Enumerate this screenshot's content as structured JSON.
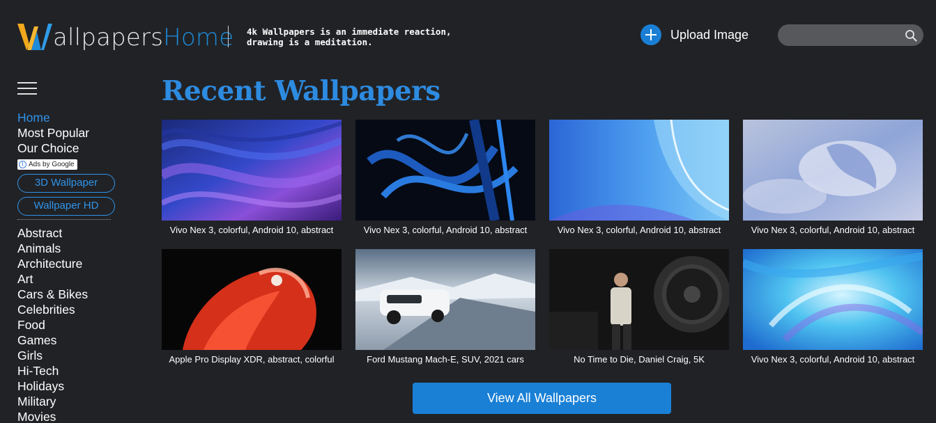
{
  "header": {
    "logo_wp": "allpapers",
    "logo_home": "Home",
    "tagline_line1": "4k Wallpapers is an immediate reaction,",
    "tagline_line2": "drawing is a meditation.",
    "upload_label": "Upload Image",
    "search_placeholder": ""
  },
  "sidebar": {
    "top_links": [
      {
        "label": "Home",
        "active": true
      },
      {
        "label": "Most Popular"
      },
      {
        "label": "Our Choice"
      }
    ],
    "ads_label": "Ads by Google",
    "pills": [
      "3D Wallpaper",
      "Wallpaper HD"
    ],
    "categories": [
      "Abstract",
      "Animals",
      "Architecture",
      "Art",
      "Cars & Bikes",
      "Celebrities",
      "Food",
      "Games",
      "Girls",
      "Hi-Tech",
      "Holidays",
      "Military",
      "Movies"
    ]
  },
  "main": {
    "title": "Recent Wallpapers",
    "wallpapers": [
      {
        "caption": "Vivo Nex 3, colorful, Android 10, abstract",
        "theme": "purple-waves"
      },
      {
        "caption": "Vivo Nex 3, colorful, Android 10, abstract",
        "theme": "dark-blue-stripes"
      },
      {
        "caption": "Vivo Nex 3, colorful, Android 10, abstract",
        "theme": "light-blue-curve"
      },
      {
        "caption": "Vivo Nex 3, colorful, Android 10, abstract",
        "theme": "pastel-clouds"
      },
      {
        "caption": "Apple Pro Display XDR, abstract, colorful",
        "theme": "red-flamingo"
      },
      {
        "caption": "Ford Mustang Mach-E, SUV, 2021 cars",
        "theme": "white-suv-snow"
      },
      {
        "caption": "No Time to Die, Daniel Craig, 5K",
        "theme": "man-dark-hangar"
      },
      {
        "caption": "Vivo Nex 3, colorful, Android 10, abstract",
        "theme": "cyan-swirl"
      }
    ],
    "view_all_label": "View All Wallpapers"
  },
  "colors": {
    "background": "#212226",
    "accent_blue": "#2d8be0",
    "button_blue": "#1a80d6",
    "logo_yellow": "#f2a81d"
  }
}
